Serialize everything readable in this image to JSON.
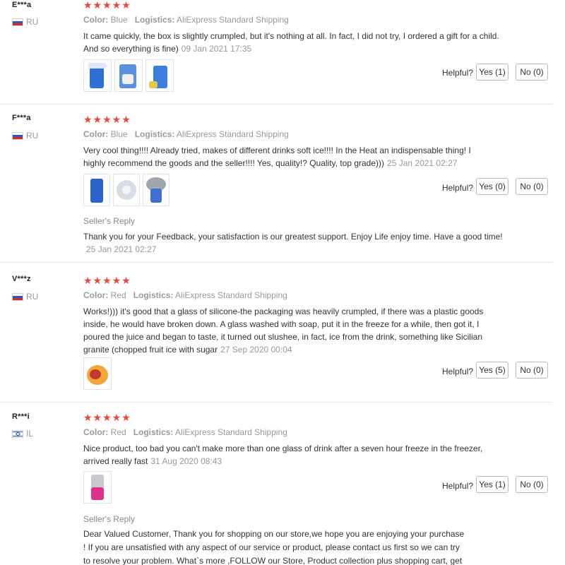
{
  "labels": {
    "color": "Color:",
    "logistics": "Logistics:",
    "helpful": "Helpful?",
    "sellers_reply": "Seller's Reply"
  },
  "stars": "★★★★★",
  "reviews": [
    {
      "user": "E***a",
      "country": "RU",
      "color": "Blue",
      "logistics": "AliExpress Standard Shipping",
      "text": "It came quickly, the box is slightly crumpled, but it's nothing at all. In fact, I did not try, I ordered a gift for a child. And so everything is fine)",
      "date": "09 Jan 2021 17:35",
      "yes": "Yes (1)",
      "no": "No (0)"
    },
    {
      "user": "F***a",
      "country": "RU",
      "color": "Blue",
      "logistics": "AliExpress Standard Shipping",
      "text": "Very cool thing!!!! Already tried, makes of different drinks soft ice!!!! In the Heat an indispensable thing! I highly recommend the goods and the seller!!!! Yes, quality!? Quality, top grade)))",
      "date": "25 Jan 2021 02:27",
      "yes": "Yes (0)",
      "no": "No (0)",
      "reply_text": "Thank you for your Feedback, your satisfaction is our greatest support. Enjoy Life enjoy time. Have a good time!",
      "reply_date": "25 Jan 2021 02:27"
    },
    {
      "user": "V***z",
      "country": "RU",
      "color": "Red",
      "logistics": "AliExpress Standard Shipping",
      "text": "Works!))) it's good that a glass of silicone-the packaging was heavily crumpled, if there was a plastic goods inside, he would have broken down. A glass washed with soap, put it in the freeze for a while, then got it, I poured the juice and began to taste, it turned out slushee, in fact, ice from the drink, something like Sicilian granite (chopped fruit ice with sugar",
      "date": "27 Sep 2020 00:04",
      "yes": "Yes (5)",
      "no": "No (0)"
    },
    {
      "user": "R***i",
      "country": "IL",
      "color": "Red",
      "logistics": "AliExpress Standard Shipping",
      "text": "Nice product, too bad you can't make more than one glass of drink after a seven hour freeze in the freezer, arrived really fast",
      "date": "31 Aug 2020 08:43",
      "yes": "Yes (1)",
      "no": "No (0)",
      "reply_text": "Dear Valued Customer, Thank you for shopping on our store,we hope you are enjoying your purchase ! If you are unsatisfied with any aspect of our service or product, please contact us first so we can try to resolve your problem. What`s more ,FOLLOW our Store, Product collection plus shopping cart, get the coupons in the first"
    }
  ]
}
